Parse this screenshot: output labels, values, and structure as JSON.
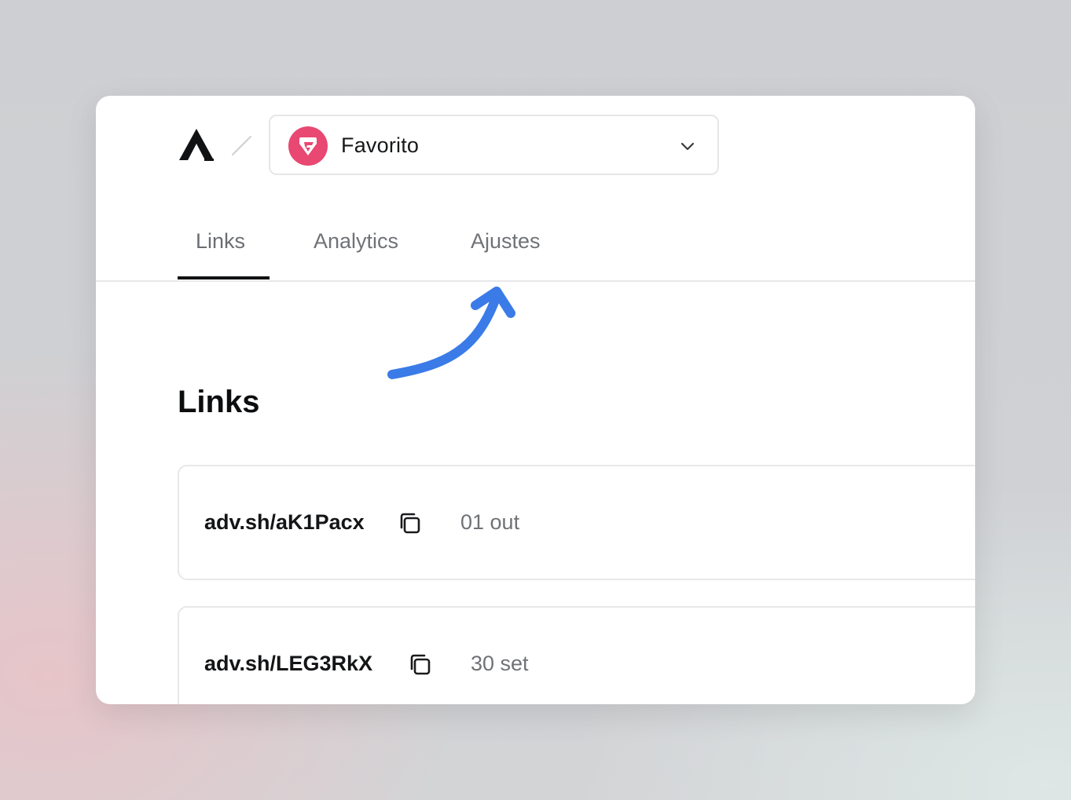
{
  "header": {
    "project_selector": {
      "name": "Favorito",
      "avatar_color": "#e84872"
    }
  },
  "tabs": [
    {
      "label": "Links",
      "active": true
    },
    {
      "label": "Analytics",
      "active": false
    },
    {
      "label": "Ajustes",
      "active": false
    }
  ],
  "annotation": {
    "arrow_color": "#3a7be8",
    "points_to": "Ajustes"
  },
  "main": {
    "title": "Links",
    "links": [
      {
        "url": "adv.sh/aK1Pacx",
        "date": "01 out"
      },
      {
        "url": "adv.sh/LEG3RkX",
        "date": "30 set"
      }
    ]
  },
  "icons": {
    "logo": "brand-logo",
    "separator": "slash",
    "dropdown": "chevron-down-icon",
    "copy": "copy-icon"
  }
}
